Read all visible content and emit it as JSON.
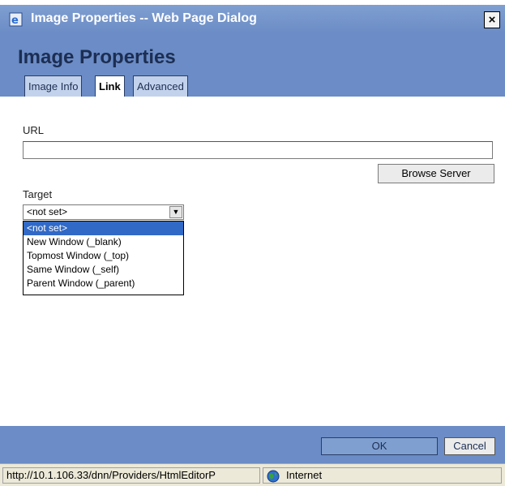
{
  "window": {
    "title": "Image Properties -- Web Page Dialog",
    "close_glyph": "×",
    "app_icon": "ie-icon"
  },
  "dialog": {
    "heading": "Image Properties",
    "tabs": [
      {
        "label": "Image Info",
        "active": false
      },
      {
        "label": "Link",
        "active": true
      },
      {
        "label": "Advanced",
        "active": false
      }
    ]
  },
  "link": {
    "url_label": "URL",
    "url_value": "",
    "browse_label": "Browse Server",
    "target_label": "Target",
    "target_selected": "<not set>",
    "target_options": [
      "<not set>",
      "New Window (_blank)",
      "Topmost Window (_top)",
      "Same Window (_self)",
      "Parent Window (_parent)"
    ]
  },
  "footer": {
    "ok_label": "OK",
    "cancel_label": "Cancel"
  },
  "statusbar": {
    "url": "http://10.1.106.33/dnn/Providers/HtmlEditorP",
    "zone": "Internet",
    "zone_icon": "globe-icon"
  },
  "colors": {
    "dialog_blue": "#6b8cc6",
    "selection": "#3169c6",
    "heading_text": "#1c2e52"
  }
}
